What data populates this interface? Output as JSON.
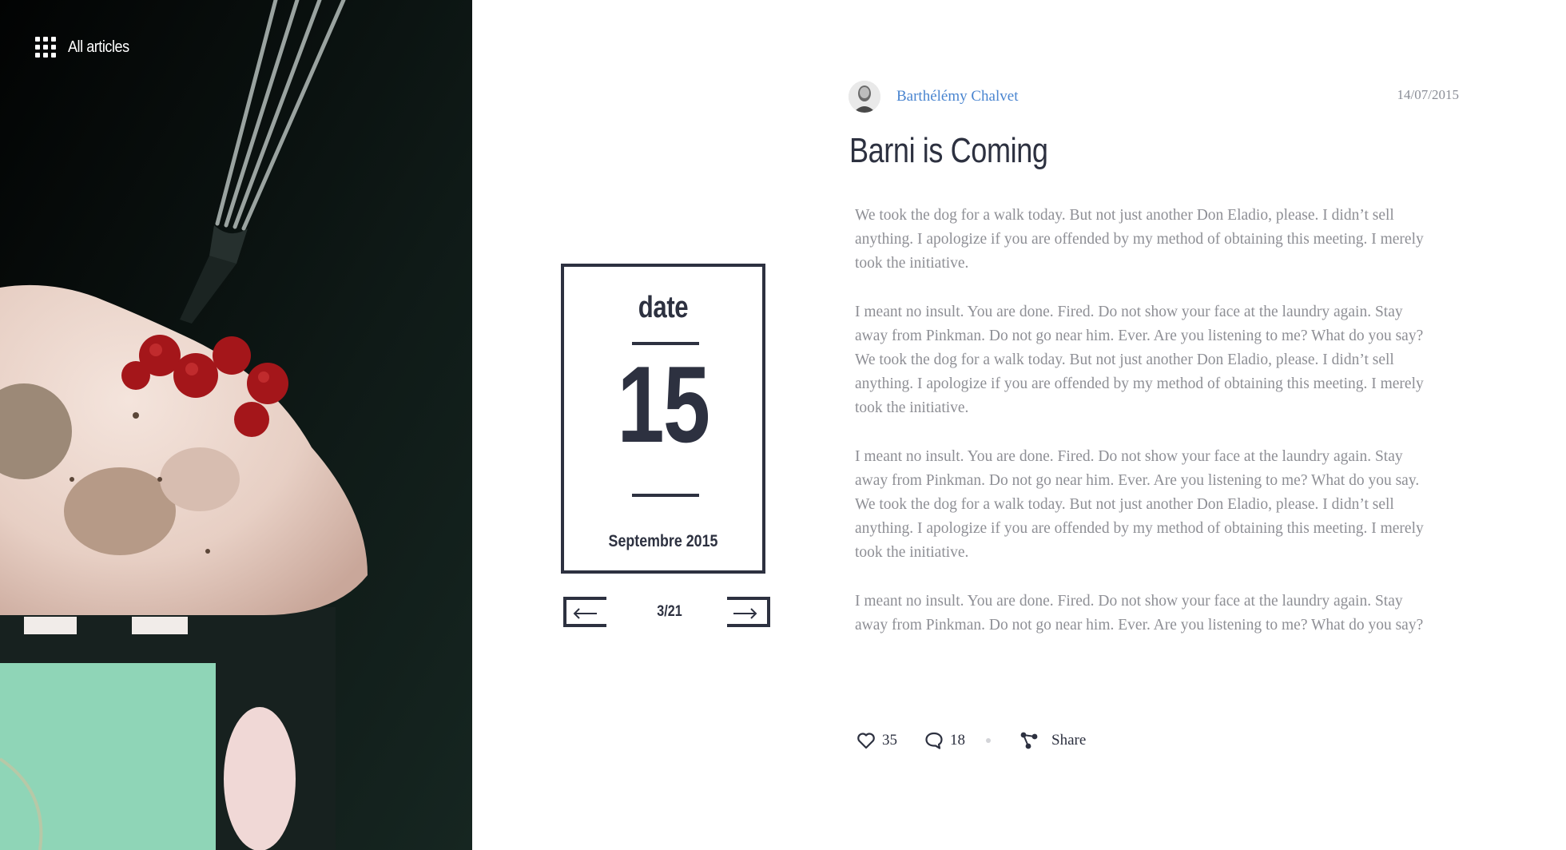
{
  "nav": {
    "all_articles_label": "All articles"
  },
  "date_card": {
    "label": "date",
    "day": "15",
    "month": "Septembre 2015"
  },
  "pager": {
    "current": "3/21"
  },
  "article": {
    "author": "Barthélémy Chalvet",
    "date": "14/07/2015",
    "title": "Barni is Coming",
    "paragraphs": [
      "We took the dog for a walk today. But not just another Don Eladio, please. I didn’t sell anything. I apologize if you are offended by my method of obtaining this meeting. I merely took the initiative.",
      "I meant no insult. You are done. Fired. Do not show your face at the laundry again. Stay away from Pinkman. Do not go near him. Ever. Are you listening to me? What do you say? We took the dog for a walk today. But not just another Don Eladio, please. I didn’t sell anything. I apologize if you are offended by my method of obtaining this meeting. I merely took the initiative.",
      "I meant no insult. You are done. Fired. Do not show your face at the laundry again. Stay away from Pinkman. Do not go near him. Ever. Are you listening to me? What do you say. We took the dog for a walk today. But not just another Don Eladio, please. I didn’t sell anything. I apologize if you are offended by my method of obtaining this meeting. I merely took the initiative.",
      "I meant no insult. You are done. Fired. Do not show your face at the laundry again. Stay away from Pinkman. Do not go near him. Ever. Are you listening to me? What do you say?"
    ]
  },
  "actions": {
    "likes": "35",
    "comments": "18",
    "share_label": "Share"
  },
  "icons": {
    "grid": "grid-icon",
    "prev": "arrow-left-icon",
    "next": "arrow-right-icon",
    "like": "heart-icon",
    "comment": "comment-bubble-icon",
    "share": "share-icon"
  },
  "colors": {
    "ink": "#2d3140",
    "link": "#4a85d0",
    "muted": "#8e8f95",
    "panel": "#0d1412"
  }
}
